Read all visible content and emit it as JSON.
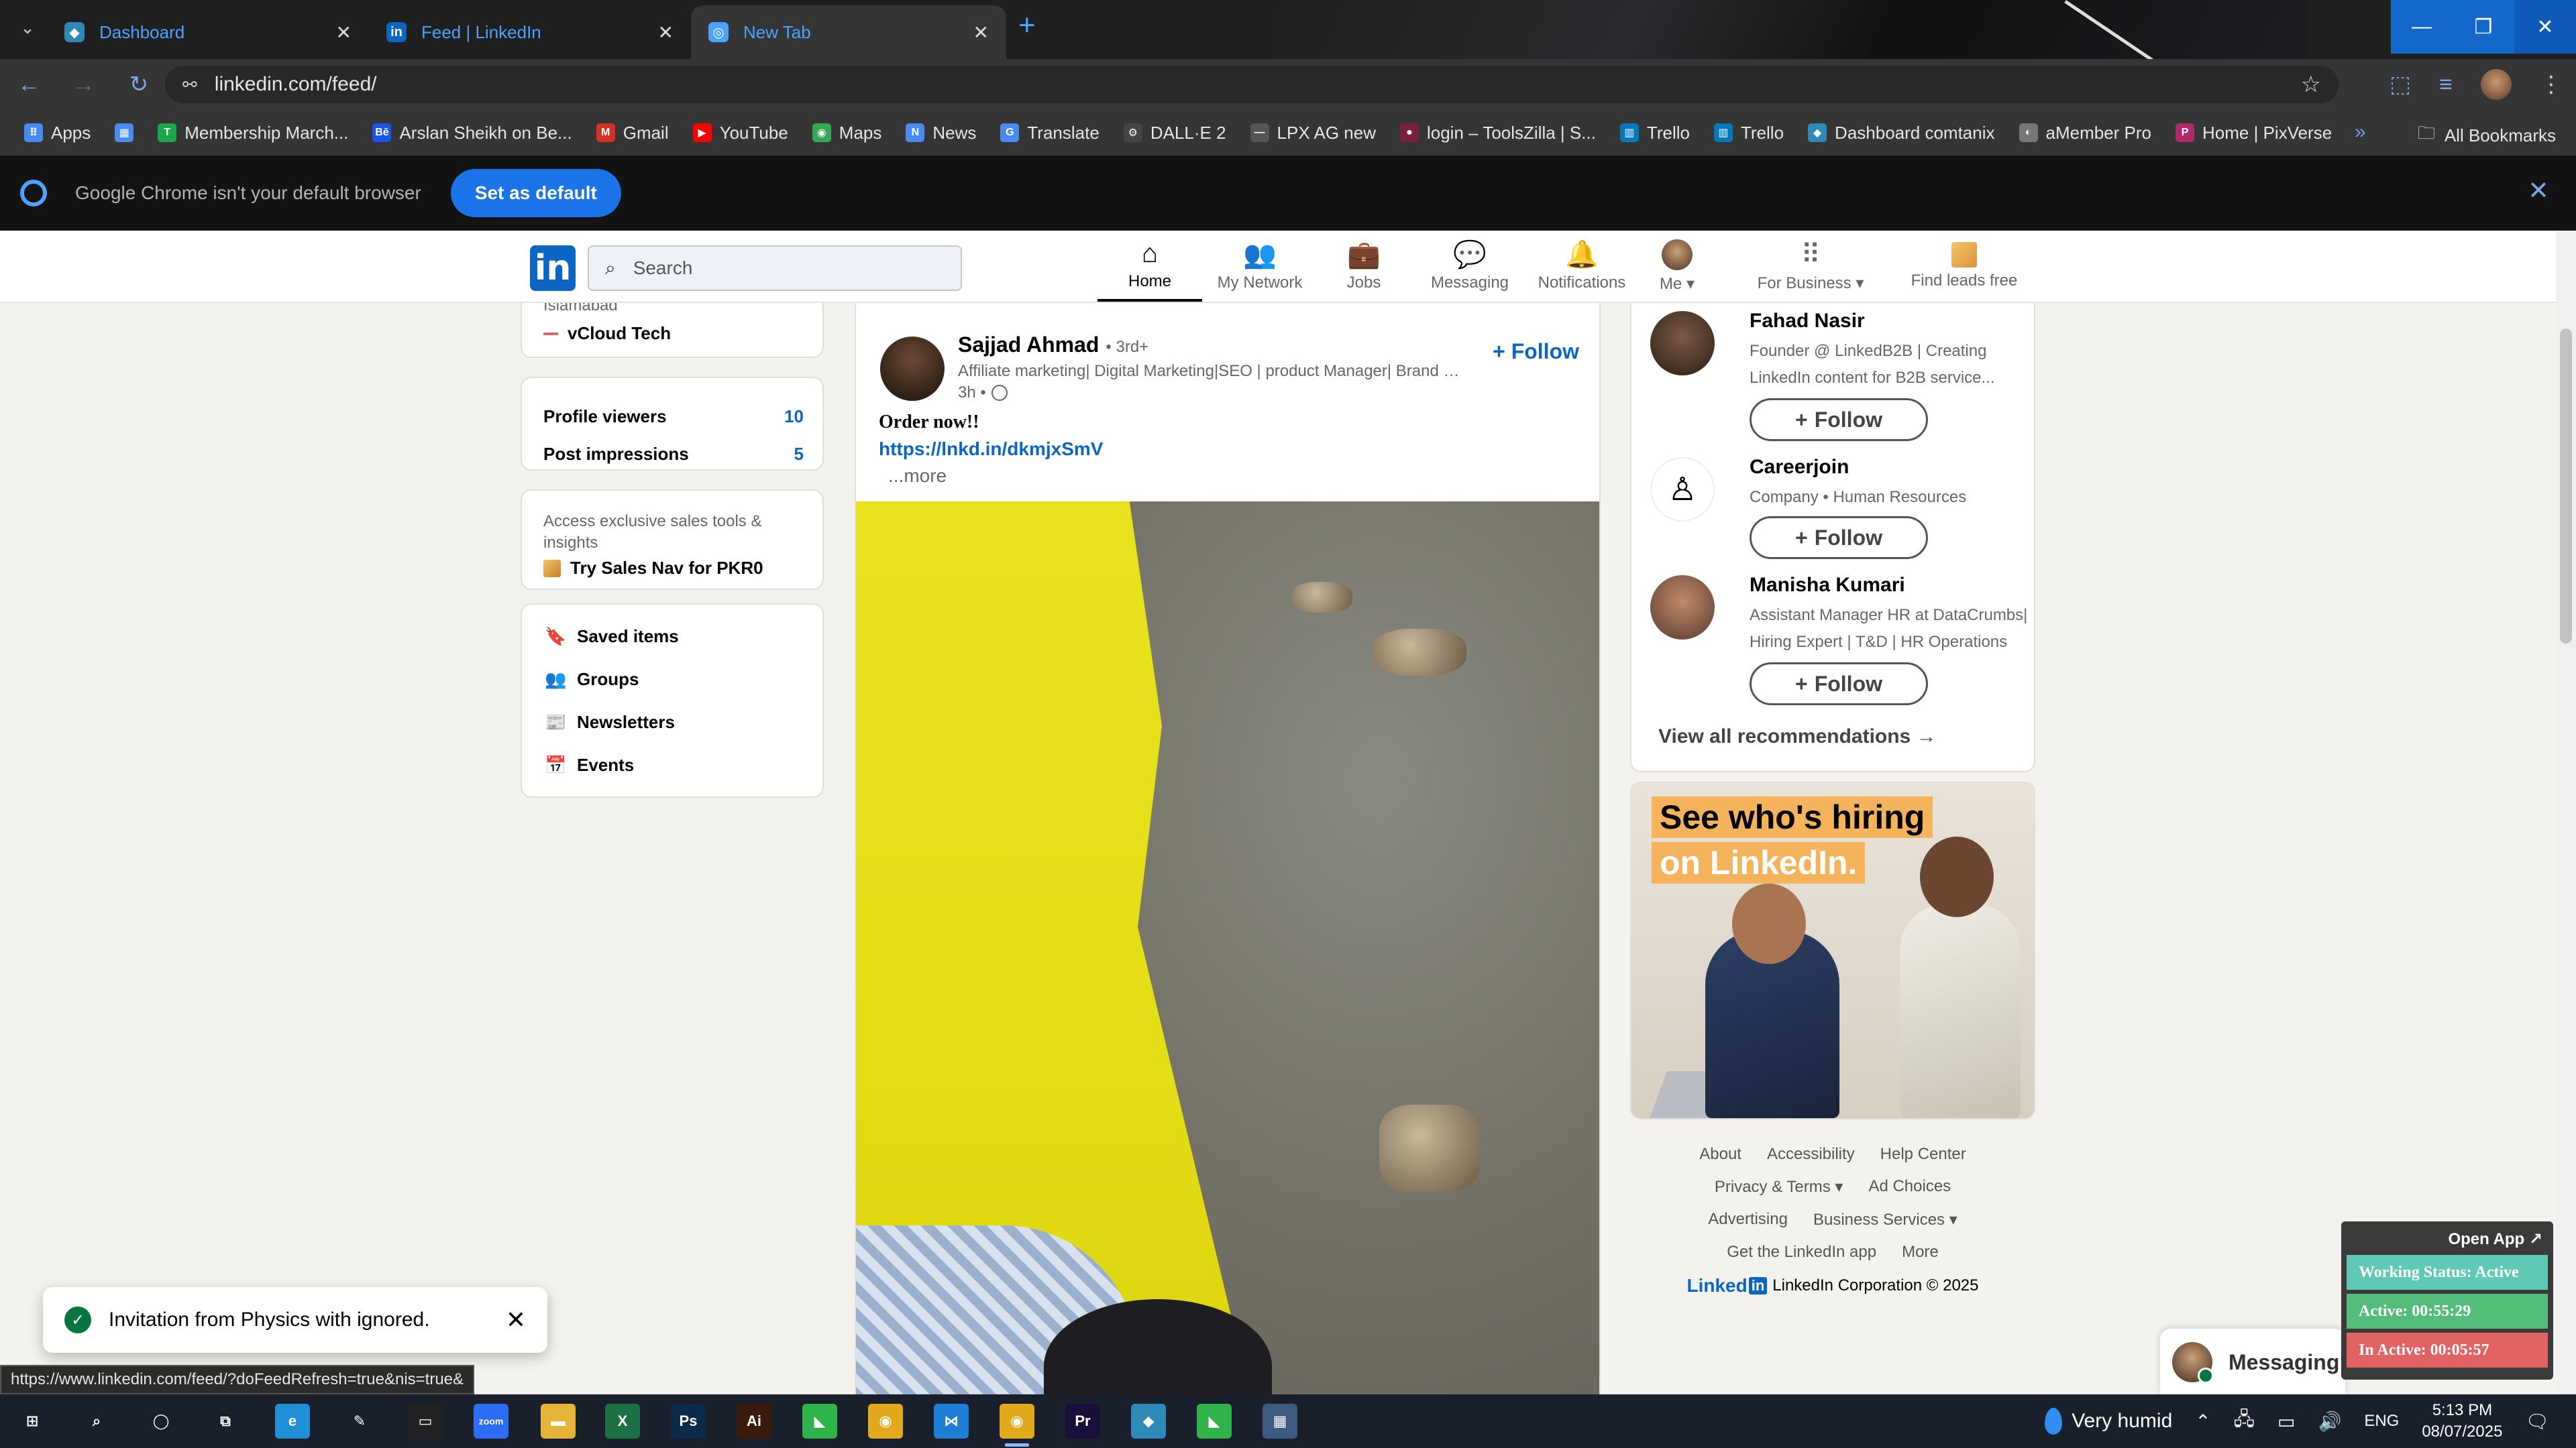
{
  "browser": {
    "tabs": [
      {
        "title": "Dashboard",
        "favicon_color": "#2d8ab8",
        "favicon_glyph": "◆"
      },
      {
        "title": "Feed | LinkedIn",
        "favicon_color": "#0a66c2",
        "favicon_glyph": "in"
      },
      {
        "title": "New Tab",
        "favicon_color": "#4aa3ff",
        "favicon_glyph": "◎"
      }
    ],
    "address": "linkedin.com/feed/",
    "bookmarks": [
      {
        "label": "Apps",
        "color": "#4a8af4",
        "glyph": "⠿"
      },
      {
        "label": "",
        "color": "#4a8af4",
        "glyph": "▦"
      },
      {
        "label": "Membership March...",
        "color": "#1aa64a",
        "glyph": "T"
      },
      {
        "label": "Arslan Sheikh on Be...",
        "color": "#1a55e8",
        "glyph": "Bē"
      },
      {
        "label": "Gmail",
        "color": "#d93025",
        "glyph": "M"
      },
      {
        "label": "YouTube",
        "color": "#ff0000",
        "glyph": "▶"
      },
      {
        "label": "Maps",
        "color": "#34a853",
        "glyph": "◉"
      },
      {
        "label": "News",
        "color": "#4a8af4",
        "glyph": "N"
      },
      {
        "label": "Translate",
        "color": "#4a8af4",
        "glyph": "G"
      },
      {
        "label": "DALL·E 2",
        "color": "#444444",
        "glyph": "⚙"
      },
      {
        "label": "LPX AG new",
        "color": "#555555",
        "glyph": "—"
      },
      {
        "label": "login – ToolsZilla | S...",
        "color": "#7a1f3d",
        "glyph": "●"
      },
      {
        "label": "Trello",
        "color": "#0079bf",
        "glyph": "▥"
      },
      {
        "label": "Trello",
        "color": "#0079bf",
        "glyph": "▥"
      },
      {
        "label": "Dashboard comtanix",
        "color": "#2d8ab8",
        "glyph": "◆"
      },
      {
        "label": "aMember Pro",
        "color": "#777777",
        "glyph": "◐"
      },
      {
        "label": "Home | PixVerse",
        "color": "#b02a6a",
        "glyph": "P"
      }
    ],
    "bookmarks_all": "All Bookmarks",
    "infobar_message": "Google Chrome isn't your default browser",
    "infobar_button": "Set as default",
    "status_url": "https://www.linkedin.com/feed/?doFeedRefresh=true&nis=true&"
  },
  "linkedin": {
    "search_placeholder": "Search",
    "nav": [
      {
        "label": "Home",
        "icon": "home-icon",
        "glyph": "⌂"
      },
      {
        "label": "My Network",
        "icon": "network-icon",
        "glyph": "👥"
      },
      {
        "label": "Jobs",
        "icon": "briefcase-icon",
        "glyph": "💼"
      },
      {
        "label": "Messaging",
        "icon": "chat-icon",
        "glyph": "💬"
      },
      {
        "label": "Notifications",
        "icon": "bell-icon",
        "glyph": "🔔"
      },
      {
        "label": "Me ▾",
        "icon": "avatar",
        "glyph": ""
      },
      {
        "label": "For Business ▾",
        "icon": "grid-icon",
        "glyph": "⠿"
      },
      {
        "label": "Find leads free",
        "icon": "leads-icon",
        "glyph": ""
      }
    ],
    "left": {
      "location": "Islamabad",
      "org": "vCloud Tech",
      "stats": [
        {
          "label": "Profile viewers",
          "value": "10"
        },
        {
          "label": "Post impressions",
          "value": "5"
        }
      ],
      "premium_text": "Access exclusive sales tools & insights",
      "premium_cta": "Try Sales Nav for PKR0",
      "links": [
        {
          "label": "Saved items",
          "glyph": "🔖"
        },
        {
          "label": "Groups",
          "glyph": "👥"
        },
        {
          "label": "Newsletters",
          "glyph": "📰"
        },
        {
          "label": "Events",
          "glyph": "📅"
        }
      ]
    },
    "post": {
      "author": "Sajjad Ahmad",
      "degree": "• 3rd+",
      "headline": "Affiliate marketing| Digital Marketing|SEO | product Manager| Brand ad...",
      "time": "3h •",
      "follow": "+ Follow",
      "text": "Order now!!",
      "link": "https://lnkd.in/dkmjxSmV",
      "more": "...more"
    },
    "recommendations": [
      {
        "name": "Fahad Nasir",
        "desc": "Founder @ LinkedB2B | Creating LinkedIn content for B2B service...",
        "button": "Follow"
      },
      {
        "name": "Careerjoin",
        "desc": "Company • Human Resources",
        "button": "Follow"
      },
      {
        "name": "Manisha Kumari",
        "desc": "Assistant Manager HR at DataCrumbs| Hiring Expert | T&D | HR Operations",
        "button": "Follow"
      }
    ],
    "view_all": "View all recommendations →",
    "ad": {
      "line1": "See who's hiring",
      "line2": "on LinkedIn."
    },
    "footer": {
      "row1": [
        "About",
        "Accessibility",
        "Help Center"
      ],
      "row2": [
        "Privacy & Terms ▾",
        "Ad Choices"
      ],
      "row3": [
        "Advertising",
        "Business Services ▾"
      ],
      "row4": [
        "Get the LinkedIn app",
        "More"
      ],
      "brand_text": "Linked",
      "brand_in": "in",
      "copyright": "LinkedIn Corporation © 2025"
    },
    "toast": "Invitation from Physics with ignored.",
    "messaging": "Messaging"
  },
  "tracker": {
    "open_app": "Open App ↗",
    "working_status": "Working Status: Active",
    "active": "Active: 00:55:29",
    "inactive": "In Active: 00:05:57"
  },
  "taskbar": {
    "weather": "Very humid",
    "lang": "ENG",
    "time": "5:13 PM",
    "date": "08/07/2025",
    "apps": [
      {
        "name": "windows-start",
        "glyph": "⊞",
        "color": "transparent"
      },
      {
        "name": "search",
        "glyph": "⌕",
        "color": "transparent"
      },
      {
        "name": "cortana",
        "glyph": "◯",
        "color": "transparent"
      },
      {
        "name": "task-view",
        "glyph": "⧉",
        "color": "transparent"
      },
      {
        "name": "edge",
        "glyph": "e",
        "color": "#1f8fd8"
      },
      {
        "name": "pen",
        "glyph": "✎",
        "color": "transparent"
      },
      {
        "name": "terminal",
        "glyph": "▭",
        "color": "#222222"
      },
      {
        "name": "zoom",
        "glyph": "zoom",
        "color": "#2d6cf5"
      },
      {
        "name": "explorer",
        "glyph": "▬",
        "color": "#e7b43a"
      },
      {
        "name": "excel",
        "glyph": "X",
        "color": "#1d7044"
      },
      {
        "name": "photoshop",
        "glyph": "Ps",
        "color": "#0c2a4a"
      },
      {
        "name": "illustrator",
        "glyph": "Ai",
        "color": "#3a1a0a"
      },
      {
        "name": "app-green",
        "glyph": "◣",
        "color": "#2fb34a"
      },
      {
        "name": "chrome",
        "glyph": "◉",
        "color": "#e2a91c"
      },
      {
        "name": "vscode",
        "glyph": "⋈",
        "color": "#1e7fd6"
      },
      {
        "name": "chrome-active",
        "glyph": "◉",
        "color": "#e2a91c"
      },
      {
        "name": "premiere",
        "glyph": "Pr",
        "color": "#1a0f3a"
      },
      {
        "name": "app-blue",
        "glyph": "◆",
        "color": "#2d8ab8"
      },
      {
        "name": "app-green2",
        "glyph": "◣",
        "color": "#2fb34a"
      },
      {
        "name": "calculator",
        "glyph": "▦",
        "color": "#3d5a80"
      }
    ]
  }
}
